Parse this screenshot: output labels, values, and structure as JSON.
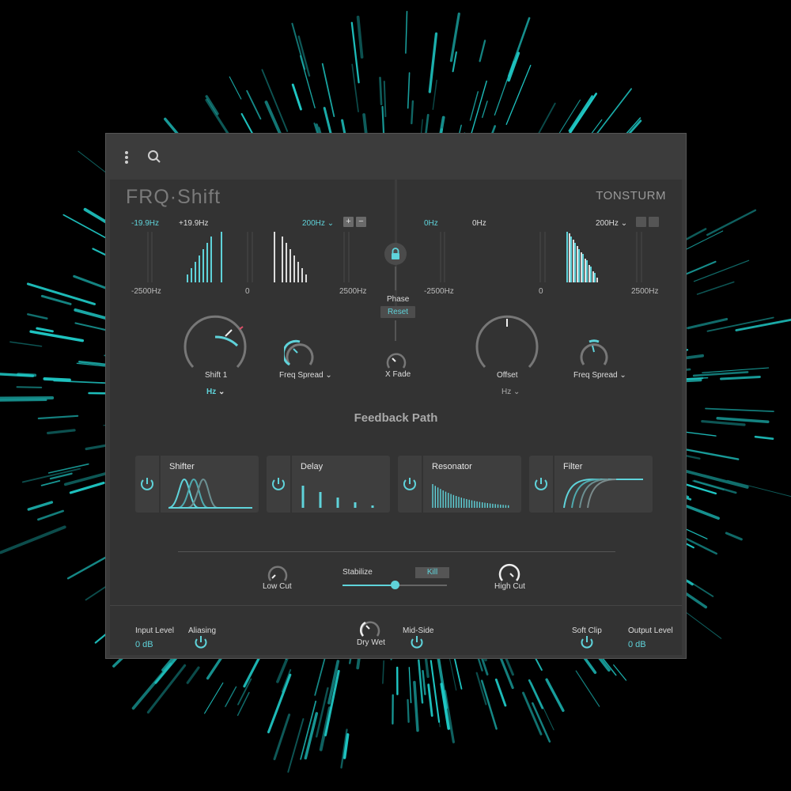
{
  "colors": {
    "accent": "#5fd3da",
    "panel": "#333333",
    "background": "#000000",
    "warning": "#e0506a"
  },
  "titlebar": {
    "menu_icon": "more-vertical-icon",
    "search_icon": "search-icon"
  },
  "plugin": {
    "logo": "FRQ·Shift",
    "brand": "TONSTURM",
    "left": {
      "freq_low": "-19.9Hz",
      "freq_high": "+19.9Hz",
      "range": "200Hz",
      "axis_min": "-2500Hz",
      "axis_mid": "0",
      "axis_max": "2500Hz",
      "knob_shift": "Shift 1",
      "unit": "Hz",
      "knob_spread": "Freq Spread"
    },
    "right": {
      "freq_low": "0Hz",
      "freq_high": "0Hz",
      "range": "200Hz",
      "axis_min": "-2500Hz",
      "axis_mid": "0",
      "axis_max": "2500Hz",
      "knob_offset": "Offset",
      "unit": "Hz",
      "knob_spread": "Freq Spread"
    },
    "center": {
      "phase": "Phase",
      "reset": "Reset",
      "xfade": "X Fade"
    },
    "feedback_title": "Feedback Path",
    "modules": [
      {
        "label": "Shifter"
      },
      {
        "label": "Delay"
      },
      {
        "label": "Resonator"
      },
      {
        "label": "Filter"
      }
    ],
    "feedback_controls": {
      "low_cut": "Low Cut",
      "stabilize": "Stabilize",
      "kill": "Kill",
      "high_cut": "High Cut",
      "stabilize_level": 0.5
    },
    "footer": {
      "input_level": "Input Level",
      "input_value": "0 dB",
      "aliasing": "Aliasing",
      "dry_wet": "Dry Wet",
      "mid_side": "Mid-Side",
      "soft_clip": "Soft Clip",
      "output_level": "Output Level",
      "output_value": "0 dB"
    }
  }
}
